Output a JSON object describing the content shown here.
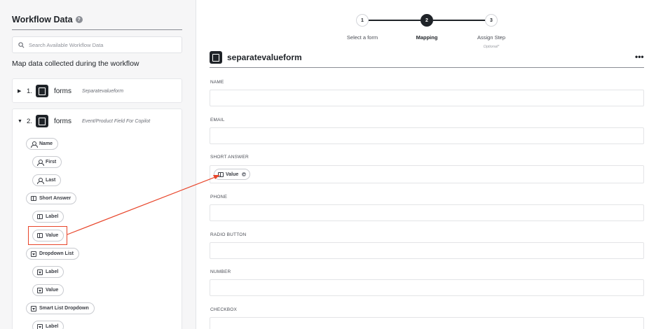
{
  "sidebar": {
    "title": "Workflow Data",
    "search_placeholder": "Search Available Workflow Data",
    "map_text": "Map data collected during the workflow",
    "groups": [
      {
        "num": "1.",
        "name": "forms",
        "sub": "Separatevalueform",
        "expanded": false
      },
      {
        "num": "2.",
        "name": "forms",
        "sub": "Event/Product Field For Copilot",
        "expanded": true
      }
    ],
    "items": [
      {
        "label": "Name",
        "icon": "person-icon"
      },
      {
        "label": "First",
        "icon": "person-icon"
      },
      {
        "label": "Last",
        "icon": "person-icon"
      },
      {
        "label": "Short Answer",
        "icon": "text-field-icon"
      },
      {
        "label": "Label",
        "icon": "text-field-icon"
      },
      {
        "label": "Value",
        "icon": "text-field-icon"
      },
      {
        "label": "Dropdown List",
        "icon": "dropdown-icon"
      },
      {
        "label": "Label",
        "icon": "dropdown-icon"
      },
      {
        "label": "Value",
        "icon": "dropdown-icon"
      },
      {
        "label": "Smart List Dropdown",
        "icon": "dropdown-icon"
      },
      {
        "label": "Label",
        "icon": "dropdown-icon"
      }
    ]
  },
  "stepper": {
    "steps": [
      {
        "num": "1",
        "label": "Select a form",
        "sub": "",
        "active": false
      },
      {
        "num": "2",
        "label": "Mapping",
        "sub": "",
        "active": true
      },
      {
        "num": "3",
        "label": "Assign Step",
        "sub": "Optional*",
        "active": false
      }
    ]
  },
  "main": {
    "form_title": "separatevalueform",
    "more_label": "•••",
    "fields": [
      {
        "label": "NAME",
        "mapped": ""
      },
      {
        "label": "EMAIL",
        "mapped": ""
      },
      {
        "label": "SHORT ANSWER",
        "mapped": "Value"
      },
      {
        "label": "PHONE",
        "mapped": ""
      },
      {
        "label": "RADIO BUTTON",
        "mapped": ""
      },
      {
        "label": "NUMBER",
        "mapped": ""
      },
      {
        "label": "CHECKBOX",
        "mapped": ""
      }
    ]
  },
  "colors": {
    "annotation": "#e8452a",
    "accent": "#1f2328"
  }
}
